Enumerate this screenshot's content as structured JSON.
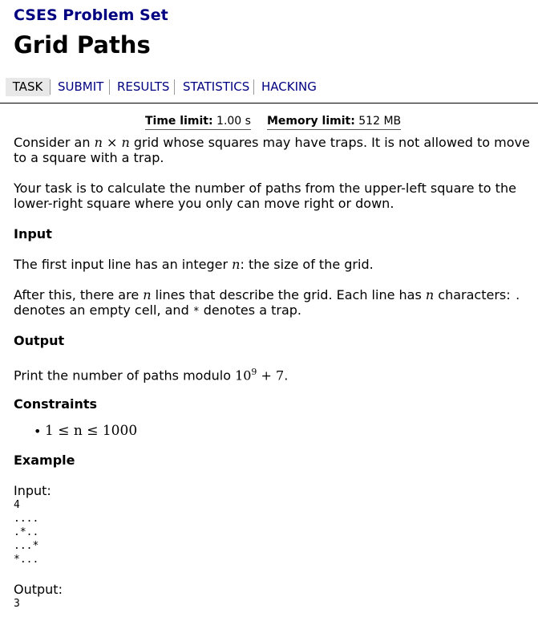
{
  "header": {
    "site_title": "CSES Problem Set",
    "problem_title": "Grid Paths"
  },
  "nav": {
    "task": "TASK",
    "submit": "SUBMIT",
    "results": "RESULTS",
    "statistics": "STATISTICS",
    "hacking": "HACKING"
  },
  "limits": {
    "time_label": "Time limit:",
    "time_value": "1.00 s",
    "memory_label": "Memory limit:",
    "memory_value": "512 MB"
  },
  "statement": {
    "p1_a": "Consider an ",
    "p1_n1": "n",
    "p1_times": " × ",
    "p1_n2": "n",
    "p1_b": " grid whose squares may have traps. It is not allowed to move",
    "p1_c": "to a square with a trap.",
    "p2_line1": "Your task is to calculate the number of paths from the upper-left square to the",
    "p2_line2": "lower-right square where you only can move right or down."
  },
  "input_section": {
    "heading": "Input",
    "line1_a": "The first input line has an integer ",
    "line1_n": "n",
    "line1_b": ": the size of the grid.",
    "line2_a": "After this, there are ",
    "line2_n1": "n",
    "line2_b": " lines that describe the grid. Each line has ",
    "line2_n2": "n",
    "line2_c": " characters: ",
    "dot": ".",
    "line3_a": "denotes an empty cell, and ",
    "star": "*",
    "line3_b": " denotes a trap."
  },
  "output_section": {
    "heading": "Output",
    "text_a": "Print the number of paths modulo ",
    "base": "10",
    "exp": "9",
    "text_b": " + 7",
    "period": "."
  },
  "constraints": {
    "heading": "Constraints",
    "bullet": "•",
    "item": "1 ≤ n ≤ 1000"
  },
  "example": {
    "heading": "Example",
    "input_label": "Input:",
    "input_lines": [
      "4",
      "....",
      ".*..",
      "...*",
      "*..."
    ],
    "output_label": "Output:",
    "output_value": "3"
  }
}
